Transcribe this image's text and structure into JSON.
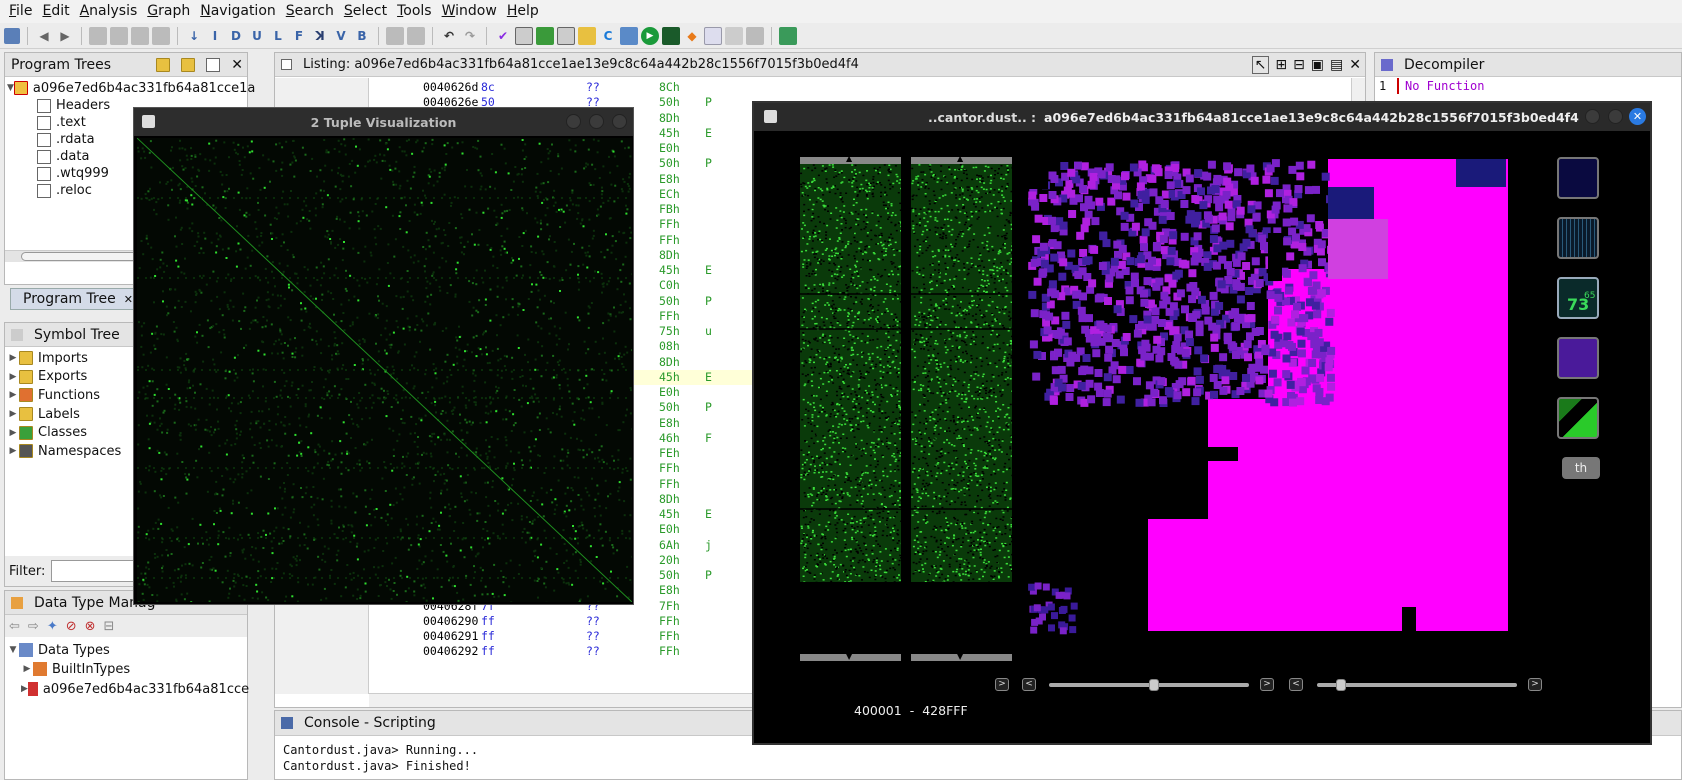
{
  "menu": [
    {
      "u": "F",
      "rest": "ile"
    },
    {
      "u": "E",
      "rest": "dit"
    },
    {
      "u": "A",
      "rest": "nalysis"
    },
    {
      "u": "G",
      "rest": "raph"
    },
    {
      "u": "N",
      "rest": "avigation"
    },
    {
      "u": "S",
      "rest": "earch"
    },
    {
      "u": "S",
      "rest": "elect"
    },
    {
      "u": "T",
      "rest": "ools"
    },
    {
      "u": "W",
      "rest": "indow"
    },
    {
      "u": "H",
      "rest": "elp"
    }
  ],
  "toolbar_icons": [
    "I",
    "D",
    "U",
    "L",
    "F",
    "V",
    "B"
  ],
  "program_trees": {
    "title": "Program Trees",
    "root": "a096e7ed6b4ac331fb64a81cce1a",
    "sections": [
      "Headers",
      ".text",
      ".rdata",
      ".data",
      ".wtq999",
      ".reloc"
    ],
    "tab_label": "Program Tree"
  },
  "symbol_tree": {
    "title": "Symbol Tree",
    "items": [
      "Imports",
      "Exports",
      "Functions",
      "Labels",
      "Classes",
      "Namespaces"
    ],
    "filter_label": "Filter:"
  },
  "data_type_manager": {
    "title": "Data Type Manag",
    "root": "Data Types",
    "items": [
      "BuiltInTypes",
      "a096e7ed6b4ac331fb64a81cce"
    ]
  },
  "listing": {
    "title": "Listing:  a096e7ed6b4ac331fb64a81cce1ae13e9c8c64a442b28c1556f7015f3b0ed4f4",
    "rows_top": [
      {
        "addr": "0040626d",
        "byte": "8c",
        "q": "??",
        "val": "8Ch",
        "ch": ""
      },
      {
        "addr": "0040626e",
        "byte": "50",
        "q": "??",
        "val": "50h",
        "ch": "P"
      }
    ],
    "rows_right": [
      {
        "val": "8Dh",
        "ch": ""
      },
      {
        "val": "45h",
        "ch": "E"
      },
      {
        "val": "E0h",
        "ch": ""
      },
      {
        "val": "50h",
        "ch": "P"
      },
      {
        "val": "E8h",
        "ch": ""
      },
      {
        "val": "ECh",
        "ch": ""
      },
      {
        "val": "FBh",
        "ch": ""
      },
      {
        "val": "FFh",
        "ch": ""
      },
      {
        "val": "FFh",
        "ch": ""
      },
      {
        "val": "8Dh",
        "ch": ""
      },
      {
        "val": "45h",
        "ch": "E"
      },
      {
        "val": "C0h",
        "ch": ""
      },
      {
        "val": "50h",
        "ch": "P"
      },
      {
        "val": "FFh",
        "ch": ""
      },
      {
        "val": "75h",
        "ch": "u"
      },
      {
        "val": "08h",
        "ch": ""
      },
      {
        "val": "8Dh",
        "ch": ""
      },
      {
        "val": "45h",
        "ch": "E"
      },
      {
        "val": "E0h",
        "ch": ""
      },
      {
        "val": "50h",
        "ch": "P"
      },
      {
        "val": "E8h",
        "ch": ""
      },
      {
        "val": "46h",
        "ch": "F"
      },
      {
        "val": "FEh",
        "ch": ""
      },
      {
        "val": "FFh",
        "ch": ""
      },
      {
        "val": "FFh",
        "ch": ""
      },
      {
        "val": "8Dh",
        "ch": ""
      },
      {
        "val": "45h",
        "ch": "E"
      },
      {
        "val": "E0h",
        "ch": ""
      },
      {
        "val": "6Ah",
        "ch": "j"
      },
      {
        "val": "20h",
        "ch": ""
      },
      {
        "val": "50h",
        "ch": "P"
      }
    ],
    "rows_bottom": [
      {
        "addr": "0040628e",
        "byte": "e8",
        "q": "??",
        "val": "E8h"
      },
      {
        "addr": "0040628f",
        "byte": "7f",
        "q": "??",
        "val": "7Fh"
      },
      {
        "addr": "00406290",
        "byte": "ff",
        "q": "??",
        "val": "FFh"
      },
      {
        "addr": "00406291",
        "byte": "ff",
        "q": "??",
        "val": "FFh"
      },
      {
        "addr": "00406292",
        "byte": "ff",
        "q": "??",
        "val": "FFh"
      }
    ]
  },
  "decompiler": {
    "title": "Decompiler",
    "line_no": "1",
    "text": "No Function"
  },
  "console": {
    "title": "Console - Scripting",
    "lines": [
      "Cantordust.java> Running...",
      "Cantordust.java> Finished!"
    ]
  },
  "tuple_window": {
    "title": "2 Tuple Visualization"
  },
  "cantor_window": {
    "title_short": "..cantor.dust..  :",
    "title_hash": "a096e7ed6b4ac331fb64a81cce1ae13e9c8c64a442b28c1556f7015f3b0ed4f4",
    "range_start": "400001",
    "range_sep": "-",
    "range_end": "428FFF",
    "th_label": "th",
    "thumb_text": "73",
    "thumb_text_small": "65"
  },
  "colors": {
    "green": "#2fbf2f",
    "magenta": "#ff00ff",
    "purple": "#7a22c8",
    "navy": "#1a1a7a"
  }
}
